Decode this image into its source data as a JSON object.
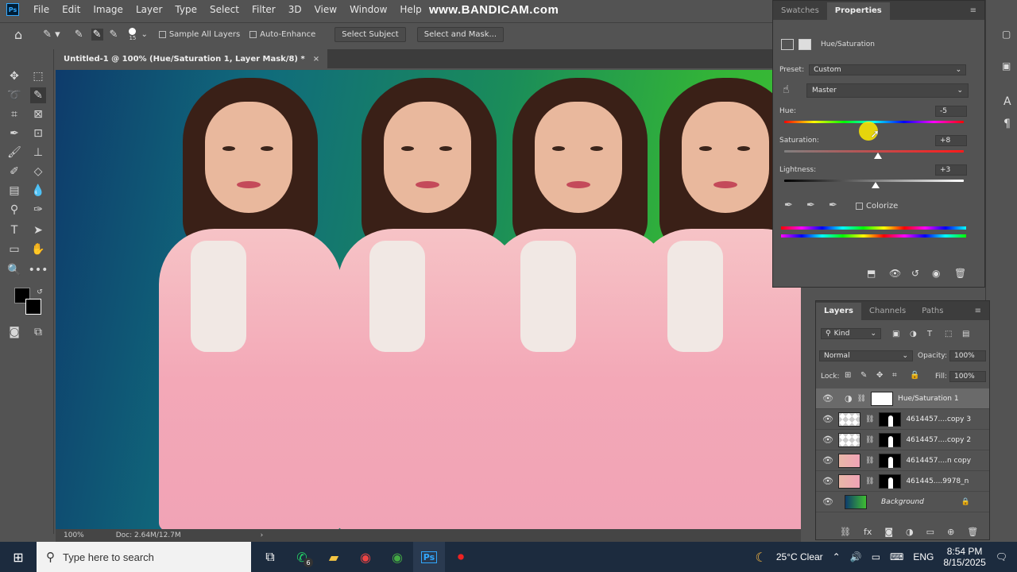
{
  "menubar": {
    "logo": "Ps",
    "items": [
      "File",
      "Edit",
      "Image",
      "Layer",
      "Type",
      "Select",
      "Filter",
      "3D",
      "View",
      "Window",
      "Help"
    ]
  },
  "watermark": "www.BANDICAM.com",
  "options": {
    "brush_size": "15",
    "sample_all_layers": "Sample All Layers",
    "auto_enhance": "Auto-Enhance",
    "select_subject": "Select Subject",
    "select_and_mask": "Select and Mask..."
  },
  "document": {
    "tab_title": "Untitled-1 @ 100% (Hue/Saturation 1, Layer Mask/8) *",
    "close": "×"
  },
  "status": {
    "zoom": "100%",
    "doc": "Doc: 2.64M/12.7M",
    "arrow": "›"
  },
  "properties": {
    "tabs": [
      "Swatches",
      "Properties"
    ],
    "adjustment_title": "Hue/Saturation",
    "preset_label": "Preset:",
    "preset_value": "Custom",
    "channel_value": "Master",
    "hue_label": "Hue:",
    "hue_value": "-5",
    "saturation_label": "Saturation:",
    "saturation_value": "+8",
    "lightness_label": "Lightness:",
    "lightness_value": "+3",
    "colorize_label": "Colorize",
    "hue_level": 0.47,
    "saturation_level": 0.52,
    "lightness_level": 0.51
  },
  "layers": {
    "tabs": [
      "Layers",
      "Channels",
      "Paths"
    ],
    "kind_label": "Kind",
    "blend_mode": "Normal",
    "opacity_label": "Opacity:",
    "opacity_value": "100%",
    "lock_label": "Lock:",
    "fill_label": "Fill:",
    "fill_value": "100%",
    "rows": [
      {
        "name": "Hue/Saturation 1",
        "selected": true
      },
      {
        "name": "4614457....copy 3"
      },
      {
        "name": "4614457....copy 2"
      },
      {
        "name": "4614457....n copy"
      },
      {
        "name": "461445....9978_n"
      },
      {
        "name": "Background"
      }
    ]
  },
  "taskbar": {
    "search_placeholder": "Type here to search",
    "whatsapp_badge": "6",
    "weather": "25°C  Clear",
    "lang": "ENG",
    "time": "8:54 PM",
    "date": "8/15/2025"
  },
  "colors": {
    "accent": "#31a8ff",
    "canvas_left": "#0e3b6b",
    "canvas_right": "#3fbe33"
  }
}
